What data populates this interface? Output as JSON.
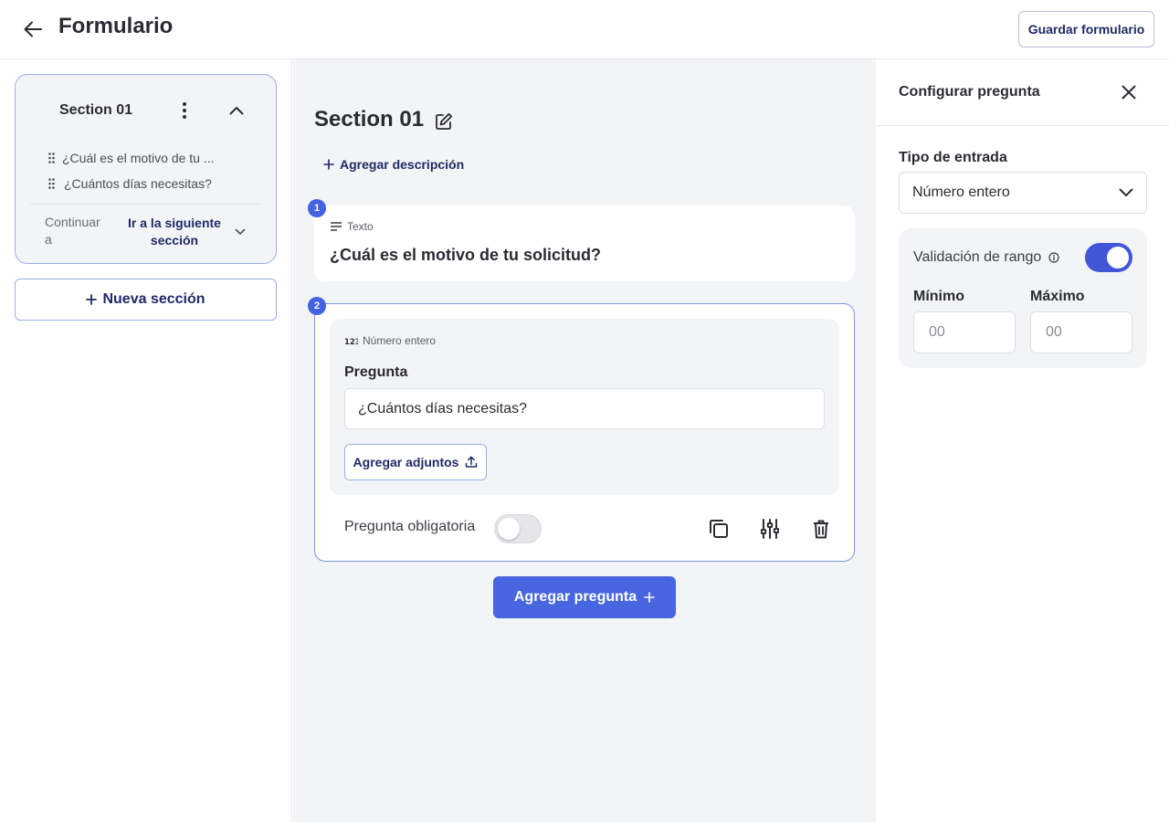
{
  "header": {
    "title": "Formulario",
    "save_label": "Guardar formulario"
  },
  "sidebar": {
    "section": {
      "title": "Section 01",
      "questions": [
        "¿Cuál es el motivo de tu ...",
        "¿Cuántos días necesitas?"
      ],
      "continue_label": "Continuar a",
      "continue_value": "Ir a la siguiente sección"
    },
    "new_section_label": "Nueva sección"
  },
  "editor": {
    "section_title": "Section 01",
    "add_description_label": "Agregar descripción",
    "questions": [
      {
        "number": "1",
        "type_label": "Texto",
        "title": "¿Cuál es el motivo de tu solicitud?"
      },
      {
        "number": "2",
        "type_label": "Número entero",
        "question_label": "Pregunta",
        "question_value": "¿Cuántos días necesitas?",
        "attach_label": "Agregar adjuntos",
        "required_label": "Pregunta obligatoria",
        "required": false
      }
    ],
    "add_question_label": "Agregar pregunta"
  },
  "config": {
    "title": "Configurar pregunta",
    "input_type_label": "Tipo de entrada",
    "input_type_value": "Número entero",
    "range_validation_label": "Validación de rango",
    "range_validation_enabled": true,
    "min_label": "Mínimo",
    "max_label": "Máximo",
    "min_placeholder": "00",
    "max_placeholder": "00"
  },
  "colors": {
    "accent": "#4766e0",
    "navy_text": "#1f2a66",
    "border_accent": "#9aaee8"
  },
  "icons": {
    "back": "arrow-left-icon",
    "kebab": "more-vertical-icon",
    "collapse": "chevron-up-icon",
    "drag": "drag-handle-icon",
    "edit": "pencil-icon",
    "text_type": "text-lines-icon",
    "number_type": "number-123-icon",
    "upload": "upload-icon",
    "copy": "copy-icon",
    "settings": "sliders-icon",
    "delete": "trash-icon",
    "close": "close-icon",
    "info": "info-icon"
  }
}
